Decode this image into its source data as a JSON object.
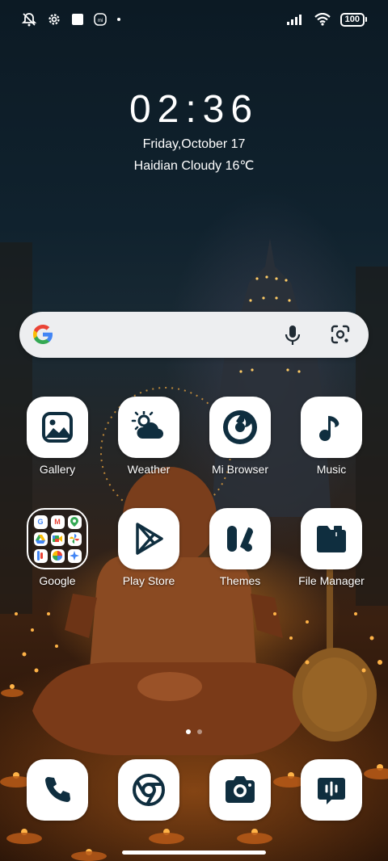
{
  "status_bar": {
    "icons_left": [
      "bell-muted-icon",
      "gear-icon",
      "square-icon",
      "mi-icon",
      "dot-icon"
    ],
    "icons_right": [
      "signal-icon",
      "wifi-icon"
    ],
    "battery": "100"
  },
  "lock": {
    "time": "02:36",
    "date": "Friday,October 17",
    "weather": "Haidian Cloudy 16℃"
  },
  "search_bar": {
    "icons": [
      "google-icon",
      "mic-icon",
      "lens-icon"
    ]
  },
  "apps": [
    {
      "label": "Gallery",
      "icon": "gallery-icon"
    },
    {
      "label": "Weather",
      "icon": "weather-icon"
    },
    {
      "label": "Mi Browser",
      "icon": "browser-icon"
    },
    {
      "label": "Music",
      "icon": "music-icon"
    },
    {
      "label": "Google",
      "icon": "google-folder-icon"
    },
    {
      "label": "Play Store",
      "icon": "play-store-icon"
    },
    {
      "label": "Themes",
      "icon": "themes-icon"
    },
    {
      "label": "File Manager",
      "icon": "folder-icon"
    }
  ],
  "google_folder_apps": [
    "G",
    "M",
    "Maps",
    "Drive",
    "Meet",
    "Pin",
    "Pay",
    "Photos",
    "Assistant"
  ],
  "page_indicator": {
    "pages": 2,
    "current": 1
  },
  "dock": [
    {
      "icon": "phone-icon"
    },
    {
      "icon": "chrome-icon"
    },
    {
      "icon": "camera-icon"
    },
    {
      "icon": "messages-icon"
    }
  ],
  "colors": {
    "icon_dark": "#0f2e3f",
    "tile": "#ffffff",
    "search_bg": "#edeef0"
  }
}
